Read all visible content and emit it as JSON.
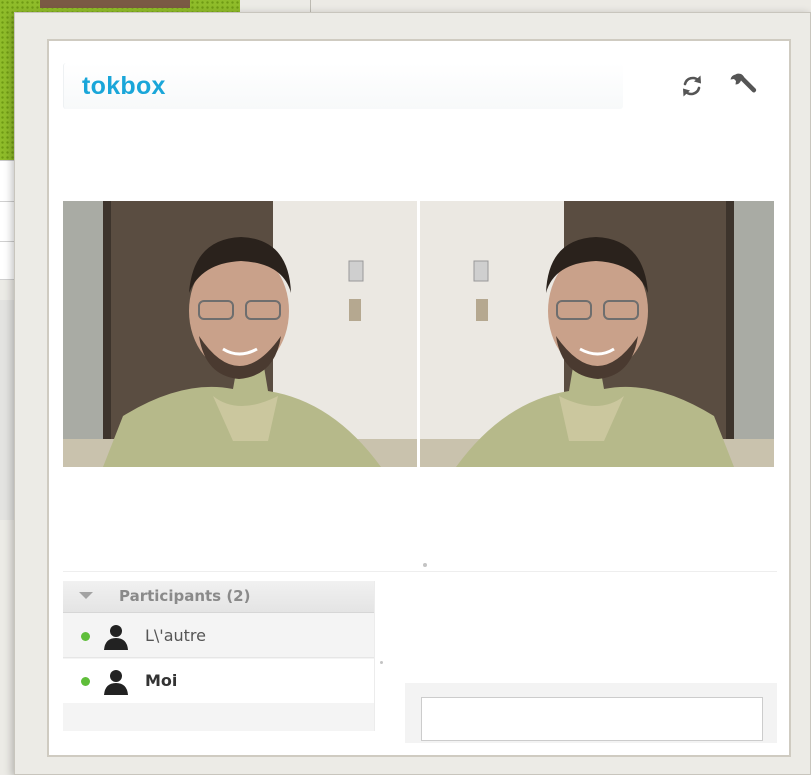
{
  "app": {
    "logo_text": "tokbox",
    "brand_color": "#1aa6d9"
  },
  "toolbar": {
    "refresh_icon": "refresh-icon",
    "settings_icon": "wrench-icon"
  },
  "videos": [
    {
      "name": "video-stream-remote"
    },
    {
      "name": "video-stream-local"
    }
  ],
  "participants": {
    "title": "Participants (2)",
    "items": [
      {
        "label": "L\\'autre",
        "status": "online",
        "status_color": "#5fbe3a"
      },
      {
        "label": "Moi",
        "status": "online",
        "status_color": "#5fbe3a"
      }
    ]
  },
  "chat": {
    "input_value": ""
  }
}
